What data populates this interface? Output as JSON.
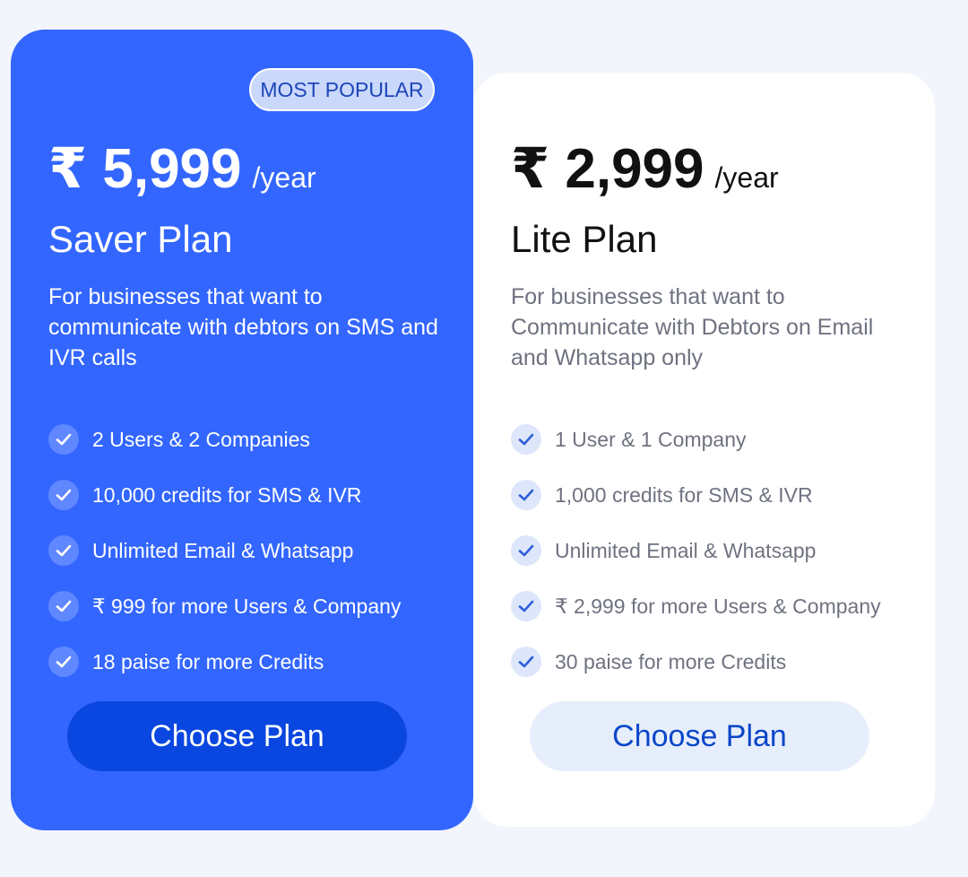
{
  "plans": [
    {
      "badge": "MOST POPULAR",
      "price": "₹ 5,999",
      "period": "/year",
      "name": "Saver Plan",
      "description": "For businesses that want to communicate with debtors on SMS and IVR calls",
      "features": [
        "2 Users & 2 Companies",
        "10,000 credits for SMS & IVR",
        "Unlimited Email & Whatsapp",
        "₹ 999 for more Users & Company",
        "18 paise for more Credits"
      ],
      "button_label": "Choose Plan",
      "accent_color": "#3366ff"
    },
    {
      "price": "₹ 2,999",
      "period": "/year",
      "name": "Lite Plan",
      "description": "For businesses that want to Communicate with Debtors on Email and Whatsapp only",
      "features": [
        "1 User & 1 Company",
        "1,000 credits for SMS & IVR",
        "Unlimited Email & Whatsapp",
        "₹ 2,999 for more Users & Company",
        "30 paise for more Credits"
      ],
      "button_label": "Choose Plan",
      "accent_color": "#ffffff"
    }
  ],
  "icons": {
    "feature": "check-icon"
  }
}
